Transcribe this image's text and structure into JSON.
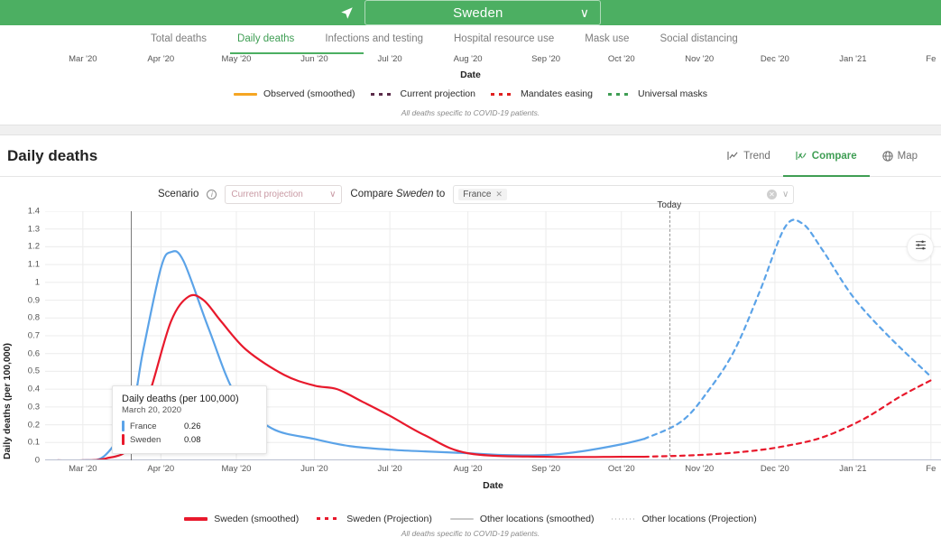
{
  "topbar": {
    "nav_icon": "navigation-arrow-icon",
    "location": "Sweden",
    "caret": "∨"
  },
  "topic_tabs": [
    {
      "label": "Total deaths",
      "active": false
    },
    {
      "label": "Daily deaths",
      "active": true
    },
    {
      "label": "Infections and testing",
      "active": false
    },
    {
      "label": "Hospital resource use",
      "active": false
    },
    {
      "label": "Mask use",
      "active": false
    },
    {
      "label": "Social distancing",
      "active": false
    }
  ],
  "top_chart": {
    "xlabel": "Date",
    "xticks": [
      "Mar '20",
      "Apr '20",
      "May '20",
      "Jun '20",
      "Jul '20",
      "Aug '20",
      "Sep '20",
      "Oct '20",
      "Nov '20",
      "Dec '20",
      "Jan '21",
      "Fe"
    ],
    "footnote": "All deaths specific to COVID-19 patients.",
    "legend": [
      {
        "label": "Observed (smoothed)",
        "color": "#f5a623",
        "style": "solid"
      },
      {
        "label": "Current projection",
        "color": "#5b2c4a",
        "style": "dashed"
      },
      {
        "label": "Mandates easing",
        "color": "#e02020",
        "style": "dashed"
      },
      {
        "label": "Universal masks",
        "color": "#3f9e54",
        "style": "dashed"
      }
    ]
  },
  "section": {
    "title": "Daily deaths",
    "view_tabs": [
      {
        "label": "Trend",
        "icon": "line-chart-icon",
        "active": false
      },
      {
        "label": "Compare",
        "icon": "compare-chart-icon",
        "active": true
      },
      {
        "label": "Map",
        "icon": "globe-icon",
        "active": false
      }
    ]
  },
  "controls": {
    "scenario_label": "Scenario",
    "info_icon": "info-icon",
    "scenario_value": "Current projection",
    "scenario_caret": "∨",
    "compare_prefix": "Compare",
    "compare_location": "Sweden",
    "compare_suffix": "to",
    "compare_chips": [
      {
        "label": "France",
        "remove": "✕"
      }
    ],
    "clear_icon": "✕",
    "compare_caret": "∨"
  },
  "tooltip": {
    "title": "Daily deaths (per 100,000)",
    "date": "March 20, 2020",
    "rows": [
      {
        "name": "France",
        "value": "0.26",
        "color": "#5ba3e8"
      },
      {
        "name": "Sweden",
        "value": "0.08",
        "color": "#e8192c"
      }
    ]
  },
  "main_chart": {
    "today_label": "Today",
    "settings_icon": "sliders-icon",
    "footnote": "All deaths specific to COVID-19 patients.",
    "legend": [
      {
        "label": "Sweden (smoothed)",
        "color": "#e8192c",
        "style": "solid-thick"
      },
      {
        "label": "Sweden (Projection)",
        "color": "#e8192c",
        "style": "dashed-thick"
      },
      {
        "label": "Other locations (smoothed)",
        "color": "#c9c9c9",
        "style": "solid-thin"
      },
      {
        "label": "Other locations (Projection)",
        "color": "#d0d0d0",
        "style": "dotted-thin"
      }
    ]
  },
  "chart_data": {
    "type": "line",
    "title": "Daily deaths",
    "xlabel": "Date",
    "ylabel": "Daily deaths (per 100,000)",
    "ylim": [
      0,
      1.4
    ],
    "yticks": [
      0,
      0.1,
      0.2,
      0.3,
      0.4,
      0.5,
      0.6,
      0.7,
      0.8,
      0.9,
      1,
      1.1,
      1.2,
      1.3,
      1.4
    ],
    "xticks": [
      "Mar '20",
      "Apr '20",
      "May '20",
      "Jun '20",
      "Jul '20",
      "Aug '20",
      "Sep '20",
      "Oct '20",
      "Nov '20",
      "Dec '20",
      "Jan '21",
      "Fe"
    ],
    "grid": true,
    "legend_position": "bottom",
    "annotations": [
      {
        "label": "Today",
        "type": "vline",
        "x": "2020-10-20"
      },
      {
        "label": "cursor",
        "type": "vline",
        "x": "2020-03-20"
      }
    ],
    "series": [
      {
        "name": "France",
        "color": "#5ba3e8",
        "observed": {
          "x": [
            "2020-02-20",
            "2020-03-01",
            "2020-03-10",
            "2020-03-20",
            "2020-03-25",
            "2020-04-01",
            "2020-04-05",
            "2020-04-10",
            "2020-04-20",
            "2020-05-01",
            "2020-05-15",
            "2020-06-01",
            "2020-06-15",
            "2020-07-01",
            "2020-07-15",
            "2020-08-01",
            "2020-08-15",
            "2020-09-01",
            "2020-09-15",
            "2020-10-01",
            "2020-10-10"
          ],
          "y": [
            0.0,
            0.0,
            0.03,
            0.26,
            0.62,
            1.08,
            1.17,
            1.12,
            0.74,
            0.36,
            0.18,
            0.12,
            0.08,
            0.06,
            0.05,
            0.04,
            0.03,
            0.03,
            0.05,
            0.09,
            0.12
          ]
        },
        "projection": {
          "x": [
            "2020-10-10",
            "2020-10-25",
            "2020-11-05",
            "2020-11-15",
            "2020-11-25",
            "2020-12-05",
            "2020-12-12",
            "2020-12-20",
            "2021-01-01",
            "2021-01-15",
            "2021-02-01"
          ],
          "y": [
            0.12,
            0.22,
            0.4,
            0.62,
            0.95,
            1.31,
            1.33,
            1.18,
            0.92,
            0.7,
            0.47
          ]
        }
      },
      {
        "name": "Sweden",
        "color": "#e8192c",
        "observed": {
          "x": [
            "2020-02-20",
            "2020-03-01",
            "2020-03-10",
            "2020-03-20",
            "2020-03-28",
            "2020-04-05",
            "2020-04-12",
            "2020-04-18",
            "2020-04-25",
            "2020-05-05",
            "2020-05-20",
            "2020-06-01",
            "2020-06-10",
            "2020-06-20",
            "2020-07-01",
            "2020-07-15",
            "2020-08-01",
            "2020-09-01",
            "2020-10-01",
            "2020-10-10"
          ],
          "y": [
            0.0,
            0.0,
            0.01,
            0.08,
            0.4,
            0.78,
            0.92,
            0.9,
            0.78,
            0.62,
            0.48,
            0.42,
            0.4,
            0.33,
            0.25,
            0.14,
            0.04,
            0.02,
            0.02,
            0.02
          ]
        },
        "projection": {
          "x": [
            "2020-10-10",
            "2020-11-01",
            "2020-11-20",
            "2020-12-05",
            "2020-12-20",
            "2021-01-05",
            "2021-01-20",
            "2021-02-01"
          ],
          "y": [
            0.02,
            0.03,
            0.05,
            0.08,
            0.13,
            0.23,
            0.36,
            0.45
          ]
        }
      }
    ]
  }
}
